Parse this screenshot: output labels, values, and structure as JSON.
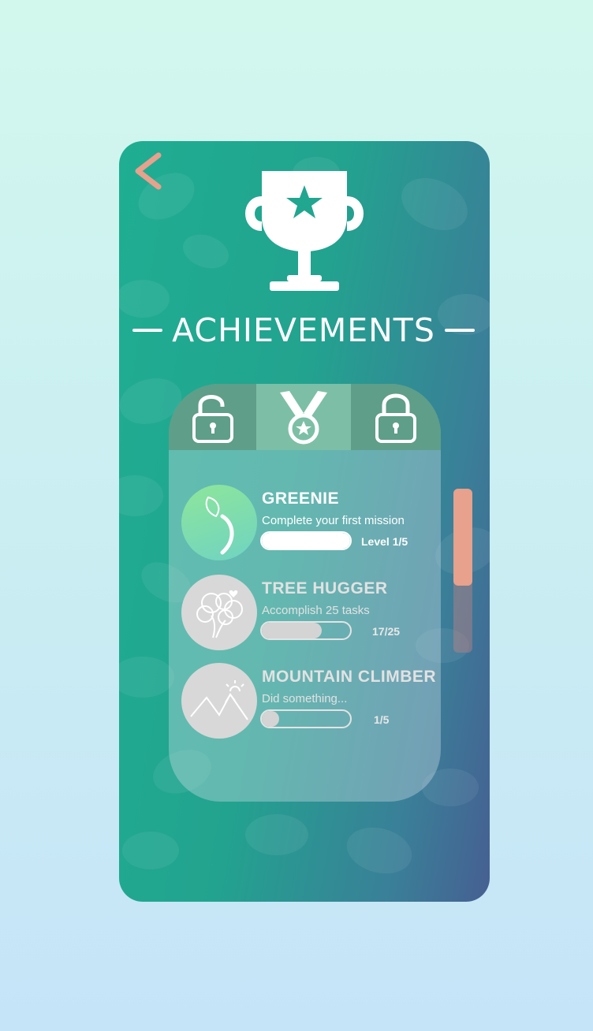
{
  "colors": {
    "accent": "#e7a18c",
    "tab_active": "#7cbfa6",
    "tab_inactive": "#5f9e88"
  },
  "title": "ACHIEVEMENTS",
  "tabs": [
    {
      "icon": "lock-open-icon",
      "active": false
    },
    {
      "icon": "medal-icon",
      "active": true
    },
    {
      "icon": "lock-icon",
      "active": false
    }
  ],
  "achievements": [
    {
      "name": "GREENIE",
      "description": "Complete your first mission",
      "progress_text": "Level 1/5",
      "progress_fraction": 1.0,
      "icon": "sprout-icon",
      "unlocked": true
    },
    {
      "name": "TREE HUGGER",
      "description": "Accomplish 25 tasks",
      "progress_text": "17/25",
      "progress_fraction": 0.68,
      "icon": "tree-heart-icon",
      "unlocked": false
    },
    {
      "name": "MOUNTAIN CLIMBER",
      "description": "Did something...",
      "progress_text": "1/5",
      "progress_fraction": 0.2,
      "icon": "mountain-icon",
      "unlocked": false
    }
  ],
  "scroll_fraction": 0.59
}
